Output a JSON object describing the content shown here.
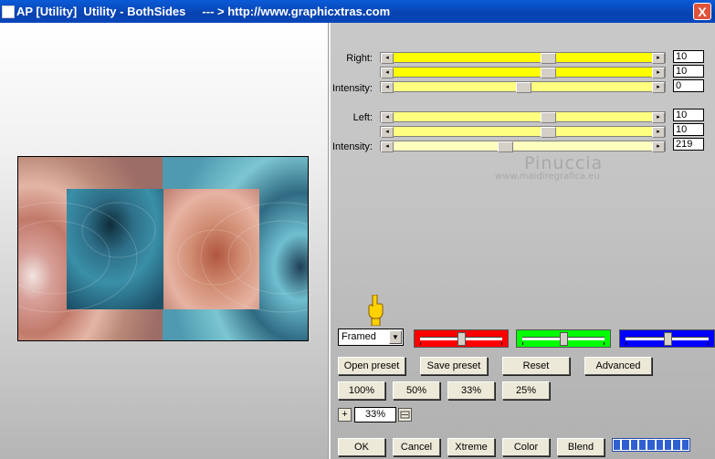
{
  "window": {
    "title": "AP [Utility]  Utility - BothSides     --- > http://www.graphicxtras.com",
    "close_label": "X"
  },
  "colors": {
    "titlebar": "#0842b0",
    "right_slider": "#ffff00",
    "left_slider": "#ffff80",
    "red": "#ff0000",
    "green": "#00ff00",
    "blue": "#0000ff"
  },
  "right_group": {
    "label": "Right:",
    "intensity_label": "Intensity:",
    "slider1_value": "10",
    "slider2_value": "10",
    "intensity_value": "0"
  },
  "left_group": {
    "label": "Left:",
    "intensity_label": "Intensity:",
    "slider1_value": "10",
    "slider2_value": "10",
    "intensity_value": "219"
  },
  "watermark": {
    "name": "Pinuccia",
    "site": "www.maidiregrafica.eu"
  },
  "frame_select": {
    "value": "Framed"
  },
  "color_sliders": {
    "red": 0.5,
    "green": 0.5,
    "blue": 0.5
  },
  "buttons": {
    "open_preset": "Open preset",
    "save_preset": "Save preset",
    "reset": "Reset",
    "advanced": "Advanced",
    "zoom100": "100%",
    "zoom50": "50%",
    "zoom33": "33%",
    "zoom25": "25%",
    "ok": "OK",
    "cancel": "Cancel",
    "xtreme": "Xtreme",
    "color": "Color",
    "blend": "Blend"
  },
  "zoom": {
    "plus": "+",
    "value": "33%"
  },
  "icons": {
    "hand": "pointing-hand-icon",
    "zoom": "zoom-fit-icon"
  }
}
